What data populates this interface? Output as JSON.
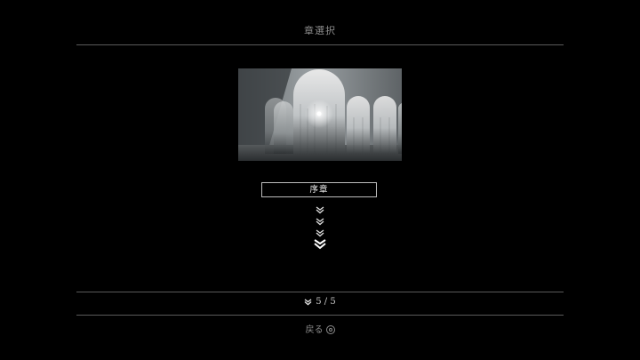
{
  "screen": {
    "title": "章選択",
    "chapter": {
      "name": "序章",
      "preview_image": "chapter-preview-arches"
    },
    "progress_markers": [
      {
        "state": "cleared"
      },
      {
        "state": "cleared"
      },
      {
        "state": "cleared"
      },
      {
        "state": "current"
      }
    ],
    "page_indicator": {
      "icon": "chevron-down-icon",
      "text": "5 / 5"
    },
    "back": {
      "label": "戻る",
      "button_icon": "circle-button-icon"
    }
  },
  "colors": {
    "background": "#000000",
    "rule": "#5a5a5a",
    "text_dim": "#8c8c8c",
    "text_bright": "#f0f0f0"
  }
}
